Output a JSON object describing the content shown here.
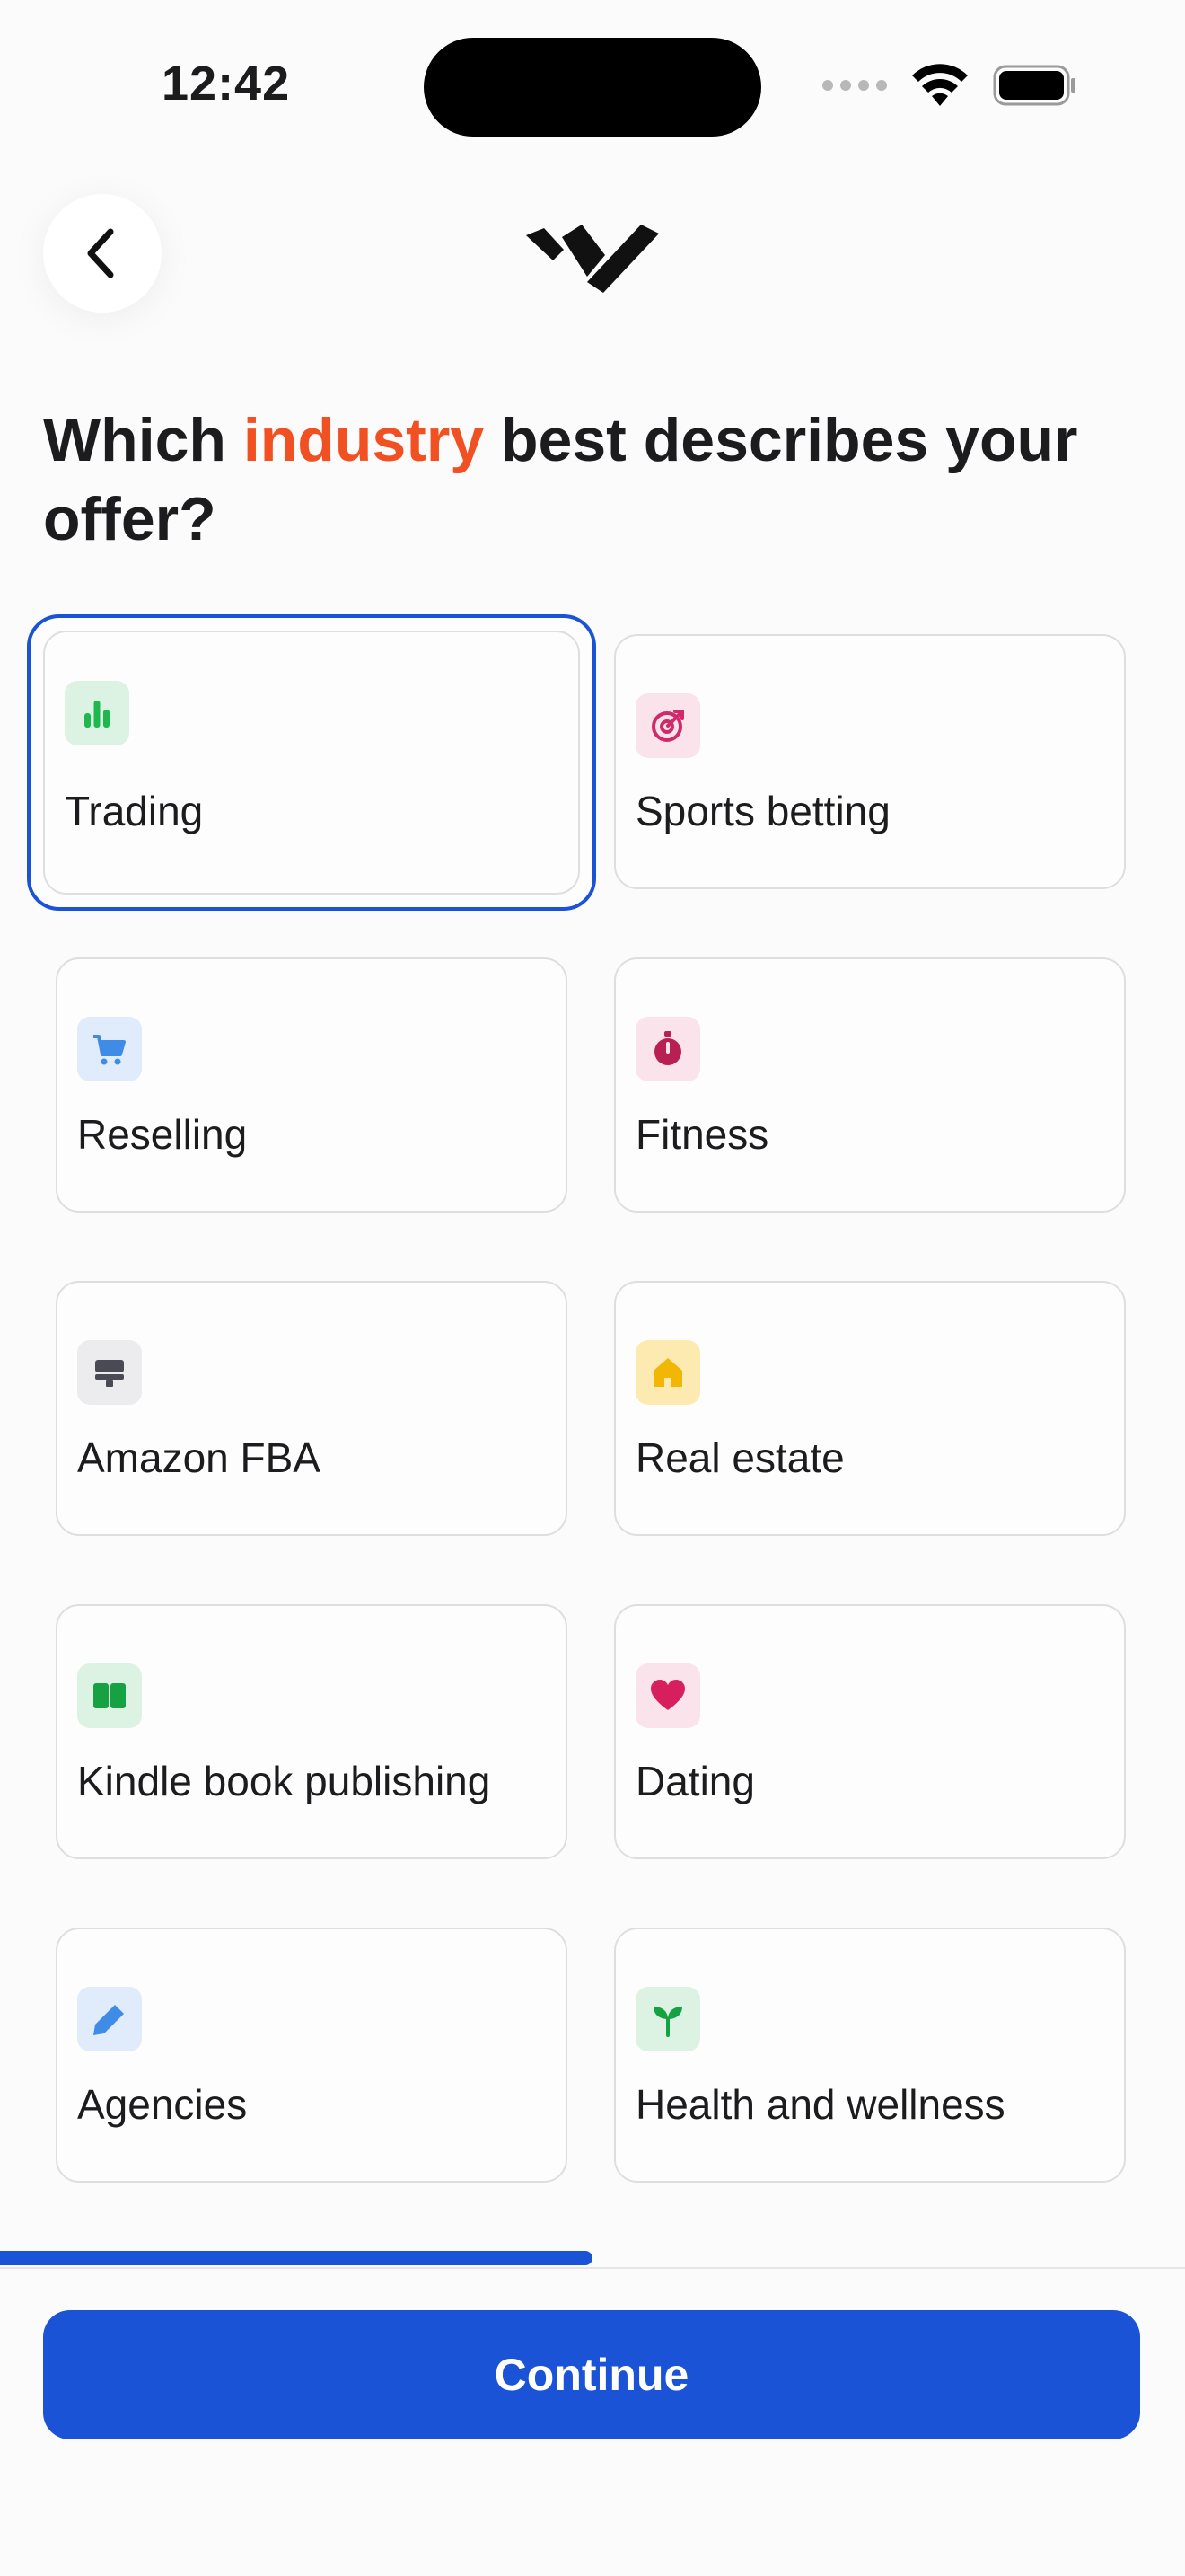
{
  "status_bar": {
    "time": "12:42",
    "wifi_icon": "wifi-icon",
    "battery_icon": "battery-icon"
  },
  "nav": {
    "back_icon": "chevron-left-icon",
    "logo": "brand-logo"
  },
  "heading": {
    "part1": "Which ",
    "highlight": "industry",
    "part2": " best describes your offer?"
  },
  "colors": {
    "accent": "#f05022",
    "primary": "#1a53d6"
  },
  "industries": [
    {
      "label": "Trading",
      "icon": "bar-chart-icon",
      "selected": true
    },
    {
      "label": "Sports betting",
      "icon": "target-icon",
      "selected": false
    },
    {
      "label": "Reselling",
      "icon": "shopping-cart-icon",
      "selected": false
    },
    {
      "label": "Fitness",
      "icon": "stopwatch-icon",
      "selected": false
    },
    {
      "label": "Amazon FBA",
      "icon": "cash-register-icon",
      "selected": false
    },
    {
      "label": "Real estate",
      "icon": "house-icon",
      "selected": false
    },
    {
      "label": "Kindle book publishing",
      "icon": "book-icon",
      "selected": false
    },
    {
      "label": "Dating",
      "icon": "heart-icon",
      "selected": false
    },
    {
      "label": "Agencies",
      "icon": "pencil-icon",
      "selected": false
    },
    {
      "label": "Health and wellness",
      "icon": "sprout-icon",
      "selected": false
    }
  ],
  "progress": {
    "fraction": 0.5
  },
  "continue_label": "Continue"
}
